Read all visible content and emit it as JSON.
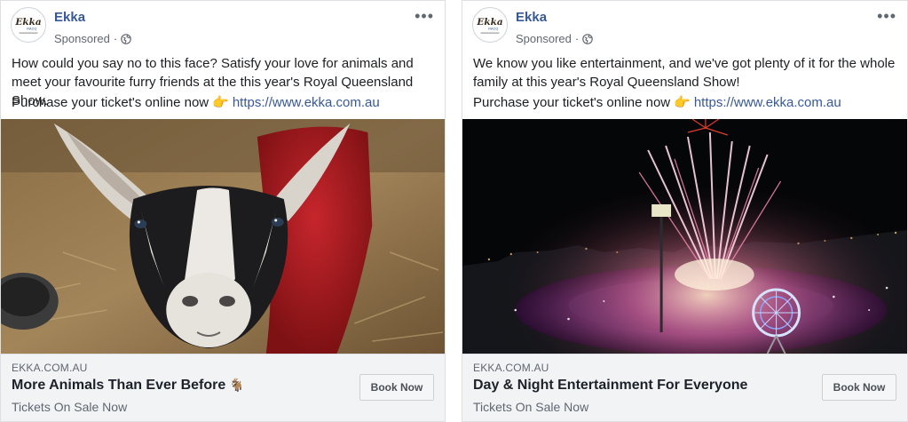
{
  "ads": [
    {
      "page_name": "Ekka",
      "logo_text": "Ekka",
      "logo_sub": "RACQ",
      "sponsored": "Sponsored",
      "sponsored_sep": "·",
      "body": "How could you say no to this face? Satisfy your love for animals and meet your favourite furry friends at the this year's Royal Queensland Show.",
      "purchase_text": "Purchase your ticket's online now",
      "hand_emoji": "👉",
      "link": "https://www.ekka.com.au",
      "domain": "EKKA.COM.AU",
      "headline": "More Animals Than Ever Before",
      "headline_emoji": "🐐",
      "subline": "Tickets On Sale Now",
      "cta": "Book Now",
      "image_subject": "goat"
    },
    {
      "page_name": "Ekka",
      "logo_text": "Ekka",
      "logo_sub": "RACQ",
      "sponsored": "Sponsored",
      "sponsored_sep": "·",
      "body": "We know you like entertainment, and we've got plenty of it for the whole family at this year's Royal Queensland Show!",
      "purchase_text": "Purchase your ticket's online now",
      "hand_emoji": "👉",
      "link": "https://www.ekka.com.au",
      "domain": "EKKA.COM.AU",
      "headline": "Day & Night Entertainment For Everyone",
      "subline": "Tickets On Sale Now",
      "cta": "Book Now",
      "image_subject": "fireworks"
    }
  ],
  "icons": [
    "more-options-icon",
    "globe-icon",
    "ekka-logo"
  ],
  "colors": {
    "link": "#385898",
    "muted": "#606770",
    "footer_bg": "#f2f3f5"
  }
}
